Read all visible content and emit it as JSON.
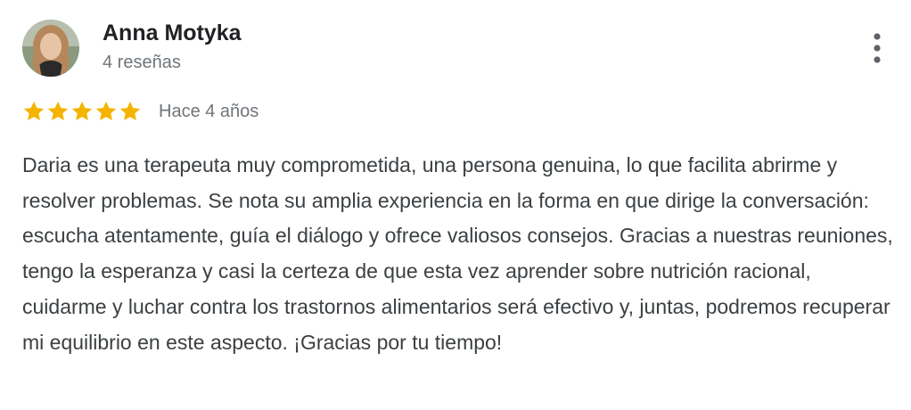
{
  "review": {
    "author_name": "Anna Motyka",
    "author_reviews": "4 reseñas",
    "rating": 5,
    "rating_max": 5,
    "date": "Hace 4 años",
    "text": "Daria es una terapeuta muy comprometida, una persona genuina, lo que facilita abrirme y resolver problemas. Se nota su amplia experiencia en la forma en que dirige la conversación: escucha atentamente, guía el diálogo y ofrece valiosos consejos. Gracias a nuestras reuniones, tengo la esperanza y casi la certeza de que esta vez aprender sobre nutrición racional, cuidarme y luchar contra los trastornos alimentarios será efectivo y, juntas, podremos recuperar mi equilibrio en este aspecto. ¡Gracias por tu tiempo!"
  },
  "icons": {
    "avatar": "avatar",
    "star": "star-icon",
    "menu": "more-vert-icon"
  },
  "colors": {
    "star": "#f4b400",
    "name": "#202124",
    "meta": "#70757a",
    "text": "#3c4043"
  }
}
